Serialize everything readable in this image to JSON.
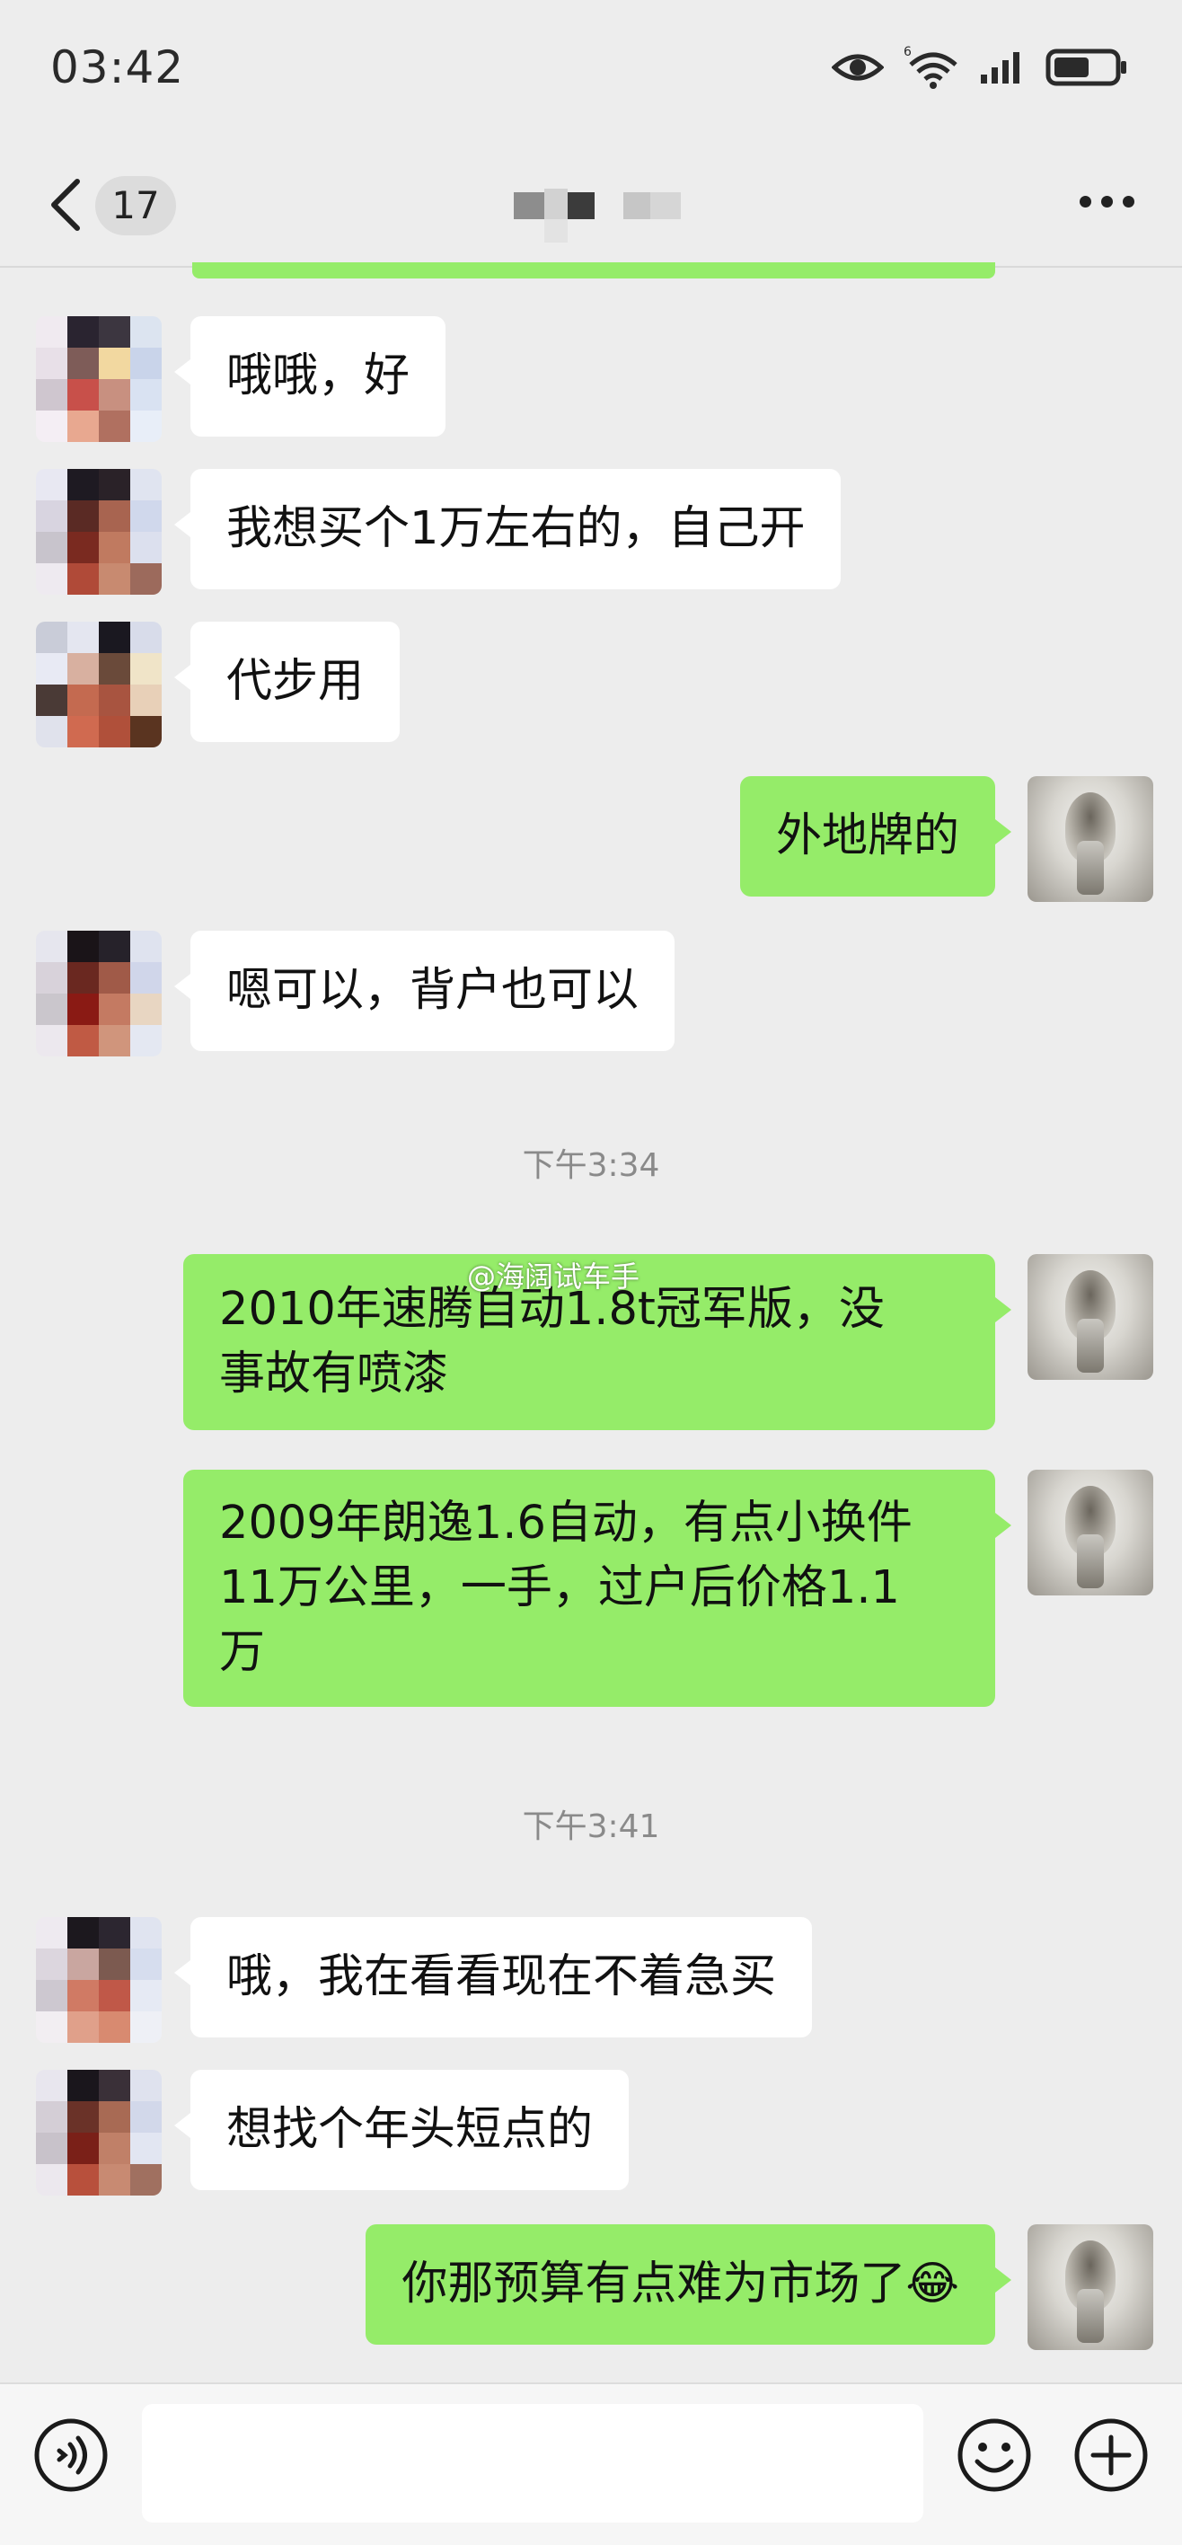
{
  "status_bar": {
    "time": "03:42",
    "network_label": "6"
  },
  "header": {
    "unread_count": "17"
  },
  "messages": [
    {
      "side": "in",
      "text": "哦哦，好"
    },
    {
      "side": "in",
      "text": "我想买个1万左右的，自己开"
    },
    {
      "side": "in",
      "text": "代步用"
    },
    {
      "side": "out",
      "text": "外地牌的"
    },
    {
      "side": "in",
      "text": "嗯可以，背户也可以"
    },
    {
      "side": "time",
      "text": "下午3:34"
    },
    {
      "side": "out",
      "text": "2010年速腾自动1.8t冠军版，没\n事故有喷漆"
    },
    {
      "side": "out",
      "text": "2009年朗逸1.6自动，有点小换件\n11万公里，一手，过户后价格1.1\n万"
    },
    {
      "side": "time",
      "text": "下午3:41"
    },
    {
      "side": "in",
      "text": "哦，我在看看现在不着急买"
    },
    {
      "side": "in",
      "text": "想找个年头短点的"
    },
    {
      "side": "out",
      "text": "你那预算有点难为市场了😂"
    }
  ],
  "watermark": "@海阔试车手",
  "input": {
    "value": ""
  },
  "colors": {
    "background": "#ededed",
    "bubble_out": "#95ec69",
    "bubble_in": "#ffffff"
  },
  "icons": [
    "back-arrow-icon",
    "more-icon",
    "eye-icon",
    "wifi-icon",
    "signal-icon",
    "battery-icon",
    "voice-icon",
    "emoji-icon",
    "plus-icon"
  ]
}
